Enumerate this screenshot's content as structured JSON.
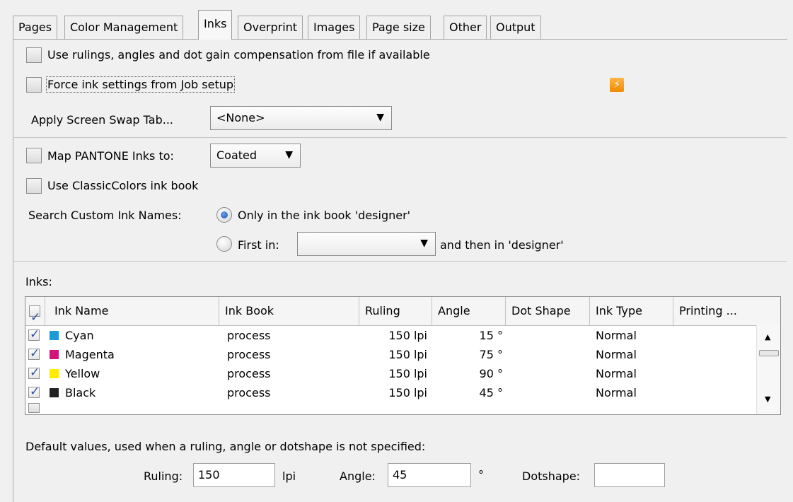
{
  "tabs": [
    "Pages",
    "Color Management",
    "Inks",
    "Overprint",
    "Images",
    "Page size",
    "Other",
    "Output"
  ],
  "active_tab": "Inks",
  "options": {
    "use_rulings": "Use rulings, angles and dot gain compensation from file if available",
    "force_ink": "Force ink settings from Job setup",
    "apply_screen_swap_label": "Apply Screen Swap Tab...",
    "apply_screen_swap_value": "<None>",
    "map_pantone_label": "Map PANTONE Inks to:",
    "map_pantone_value": "Coated",
    "classic_colors": "Use ClassicColors ink book",
    "search_label": "Search Custom Ink Names:",
    "radio_only": "Only in the ink book 'designer'",
    "radio_first": "First in:",
    "first_in_value": "",
    "then_in": "and then in 'designer'"
  },
  "inks_label": "Inks:",
  "table": {
    "columns": [
      "Ink Name",
      "Ink Book",
      "Ruling",
      "Angle",
      "Dot Shape",
      "Ink Type",
      "Printing ..."
    ],
    "rows": [
      {
        "name": "Cyan",
        "color": "#1e9bd7",
        "book": "process",
        "ruling": "150 lpi",
        "angle": "15 °",
        "dot": "",
        "type": "Normal"
      },
      {
        "name": "Magenta",
        "color": "#d3137a",
        "book": "process",
        "ruling": "150 lpi",
        "angle": "75 °",
        "dot": "",
        "type": "Normal"
      },
      {
        "name": "Yellow",
        "color": "#ffed00",
        "book": "process",
        "ruling": "150 lpi",
        "angle": "90 °",
        "dot": "",
        "type": "Normal"
      },
      {
        "name": "Black",
        "color": "#222222",
        "book": "process",
        "ruling": "150 lpi",
        "angle": "45 °",
        "dot": "",
        "type": "Normal"
      }
    ]
  },
  "defaults": {
    "note": "Default values, used when a ruling, angle or dotshape is not specified:",
    "ruling_label": "Ruling:",
    "ruling_value": "150",
    "ruling_unit": "lpi",
    "angle_label": "Angle:",
    "angle_value": "45",
    "angle_unit": "°",
    "dotshape_label": "Dotshape:",
    "dotshape_value": ""
  },
  "icons": {
    "flash": "lightning-bolt-icon"
  }
}
